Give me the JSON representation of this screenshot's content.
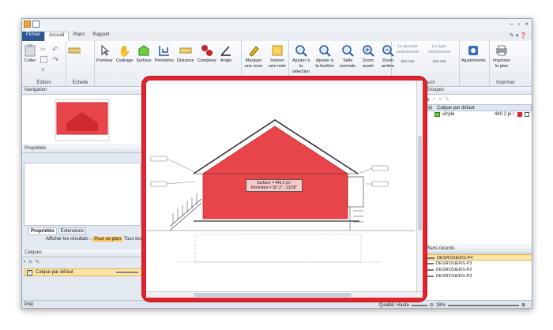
{
  "tabs": [
    {
      "label": "Fichier"
    },
    {
      "label": "Accueil"
    },
    {
      "label": "Plans"
    },
    {
      "label": "Rapport"
    }
  ],
  "ribbon": {
    "edition": {
      "label": "Édition",
      "coller": "Coller"
    },
    "echelle": {
      "label": "Échelle"
    },
    "tools": [
      {
        "label": "Pointeur"
      },
      {
        "label": "Cadrage"
      },
      {
        "label": "Surface"
      },
      {
        "label": "Périmètre"
      },
      {
        "label": "Distance"
      },
      {
        "label": "Compteur"
      },
      {
        "label": "Angle"
      },
      {
        "label": "Marquer une zone"
      },
      {
        "label": "Insérer une note"
      },
      {
        "label": "Ajuster à la sélection"
      },
      {
        "label": "Ajuster à la fenêtre"
      },
      {
        "label": "Taille normale"
      },
      {
        "label": "Zoom avant"
      },
      {
        "label": "Zoom arrière"
      },
      {
        "label": "Le groupe sélectionné"
      },
      {
        "label": "Le type sélectionné"
      },
      {
        "label": "Ajustements"
      },
      {
        "label": "Imprimer le plan"
      }
    ],
    "parcourir_label": "Parcourir",
    "imprimer_label": "Imprimer"
  },
  "left": {
    "navigation_title": "Navigation",
    "properties_title": "Propriétés",
    "subtabs": [
      "Propriétés",
      "Extensions"
    ],
    "show_results_label": "Afficher les résultats :",
    "show_results_opt1": "Pour ce plan",
    "show_results_opt2": "Tous les plans",
    "layers_title": "Calques",
    "layer_default": "Calque par défaut"
  },
  "drawing": {
    "measure_line1": "Surface = 440.2 pi.²",
    "measure_line2": "Périmètre = 92' 2\" - 31/35\""
  },
  "right": {
    "groups_title": "Groupes",
    "group_layer": "Calque par défaut",
    "group_item": "vinyle",
    "group_value": "440.2 pi.²",
    "recent_title": "Plans récents",
    "recent": [
      "DESROSIERS-P4",
      "DESROSIERS-P3",
      "DESROSIERS-P2",
      "DESROSIERS-P3"
    ]
  },
  "status": {
    "left": "Prêt",
    "quality": "Qualité: Haute",
    "zoom": "28%"
  },
  "colors": {
    "highlight": "#e0242d",
    "fill": "#e8454b",
    "selection": "#fbe4a6"
  }
}
